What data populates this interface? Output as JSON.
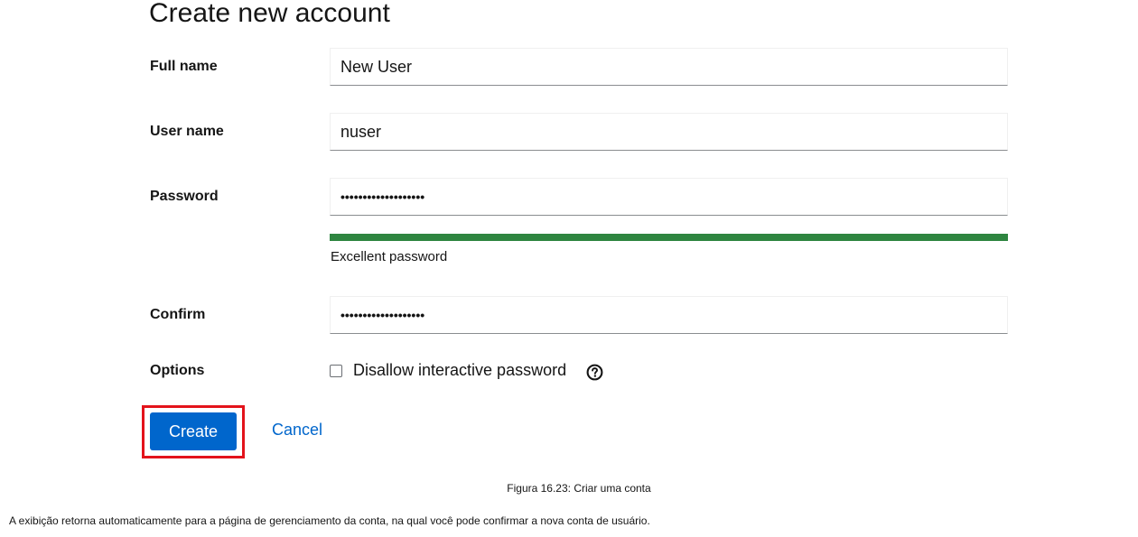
{
  "form": {
    "title": "Create new account",
    "full_name": {
      "label": "Full name",
      "value": "New User"
    },
    "user_name": {
      "label": "User name",
      "value": "nuser"
    },
    "password": {
      "label": "Password",
      "value": "•••••••••••••••••••",
      "strength_text": "Excellent password",
      "strength_level": 1.0,
      "strength_color": "#2e8540"
    },
    "confirm": {
      "label": "Confirm",
      "value": "•••••••••••••••••••"
    },
    "options": {
      "label": "Options",
      "checkbox_label": "Disallow interactive password",
      "checked": false,
      "help_icon": "help-circle-icon"
    },
    "create_button": "Create",
    "cancel_link": "Cancel",
    "highlight_color": "#e3131b",
    "accent_color": "#0066cc"
  },
  "doc": {
    "caption": "Figura 16.23: Criar uma conta",
    "paragraph": "A exibição retorna automaticamente para a página de gerenciamento da conta, na qual você pode confirmar a nova conta de usuário."
  }
}
